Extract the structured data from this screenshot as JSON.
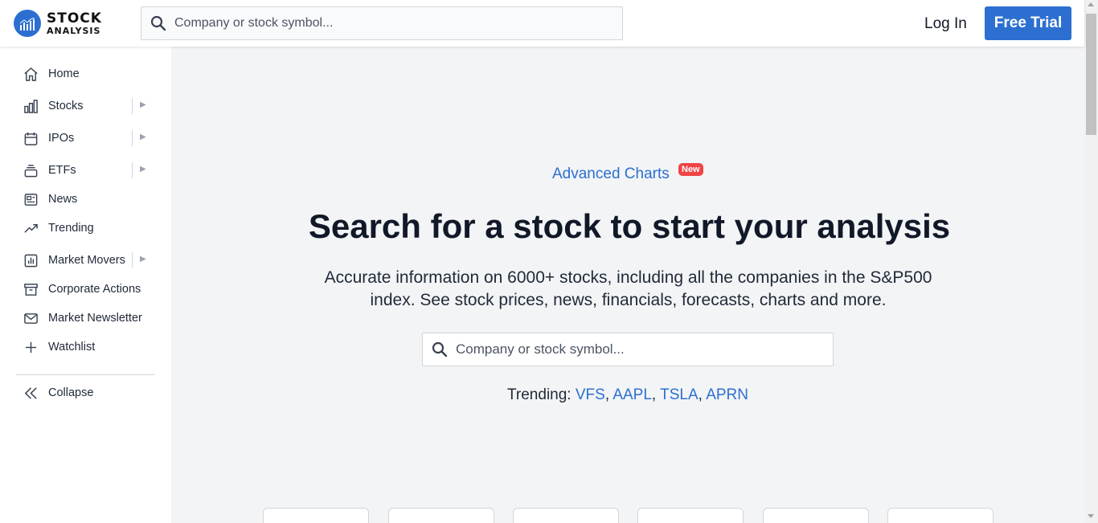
{
  "brand": {
    "line1": "STOCK",
    "line2": "ANALYSIS",
    "accent": "#2c6fd1"
  },
  "header": {
    "search_placeholder": "Company or stock symbol...",
    "login_label": "Log In",
    "trial_label": "Free Trial"
  },
  "sidebar": {
    "items": [
      {
        "label": "Home",
        "icon": "home-icon",
        "expandable": false
      },
      {
        "label": "Stocks",
        "icon": "bar-chart-icon",
        "expandable": true
      },
      {
        "label": "IPOs",
        "icon": "calendar-icon",
        "expandable": true
      },
      {
        "label": "ETFs",
        "icon": "stack-icon",
        "expandable": true
      },
      {
        "label": "News",
        "icon": "newspaper-icon",
        "expandable": false
      },
      {
        "label": "Trending",
        "icon": "trending-icon",
        "expandable": false
      },
      {
        "label": "Market Movers",
        "icon": "chart-box-icon",
        "expandable": true
      },
      {
        "label": "Corporate Actions",
        "icon": "archive-icon",
        "expandable": false
      },
      {
        "label": "Market Newsletter",
        "icon": "mail-icon",
        "expandable": false
      },
      {
        "label": "Watchlist",
        "icon": "plus-icon",
        "expandable": false
      }
    ],
    "collapse_label": "Collapse"
  },
  "main": {
    "advanced_charts_label": "Advanced Charts",
    "new_badge": "New",
    "headline": "Search for a stock to start your analysis",
    "description": "Accurate information on 6000+ stocks, including all the companies in the S&P500 index. See stock prices, news, financials, forecasts, charts and more.",
    "search_placeholder": "Company or stock symbol...",
    "trending_label": "Trending:",
    "trending_symbols": [
      "VFS",
      "AAPL",
      "TSLA",
      "APRN"
    ]
  },
  "colors": {
    "accent": "#2c6fd1",
    "badge": "#ef4444",
    "background": "#f3f4f6"
  }
}
